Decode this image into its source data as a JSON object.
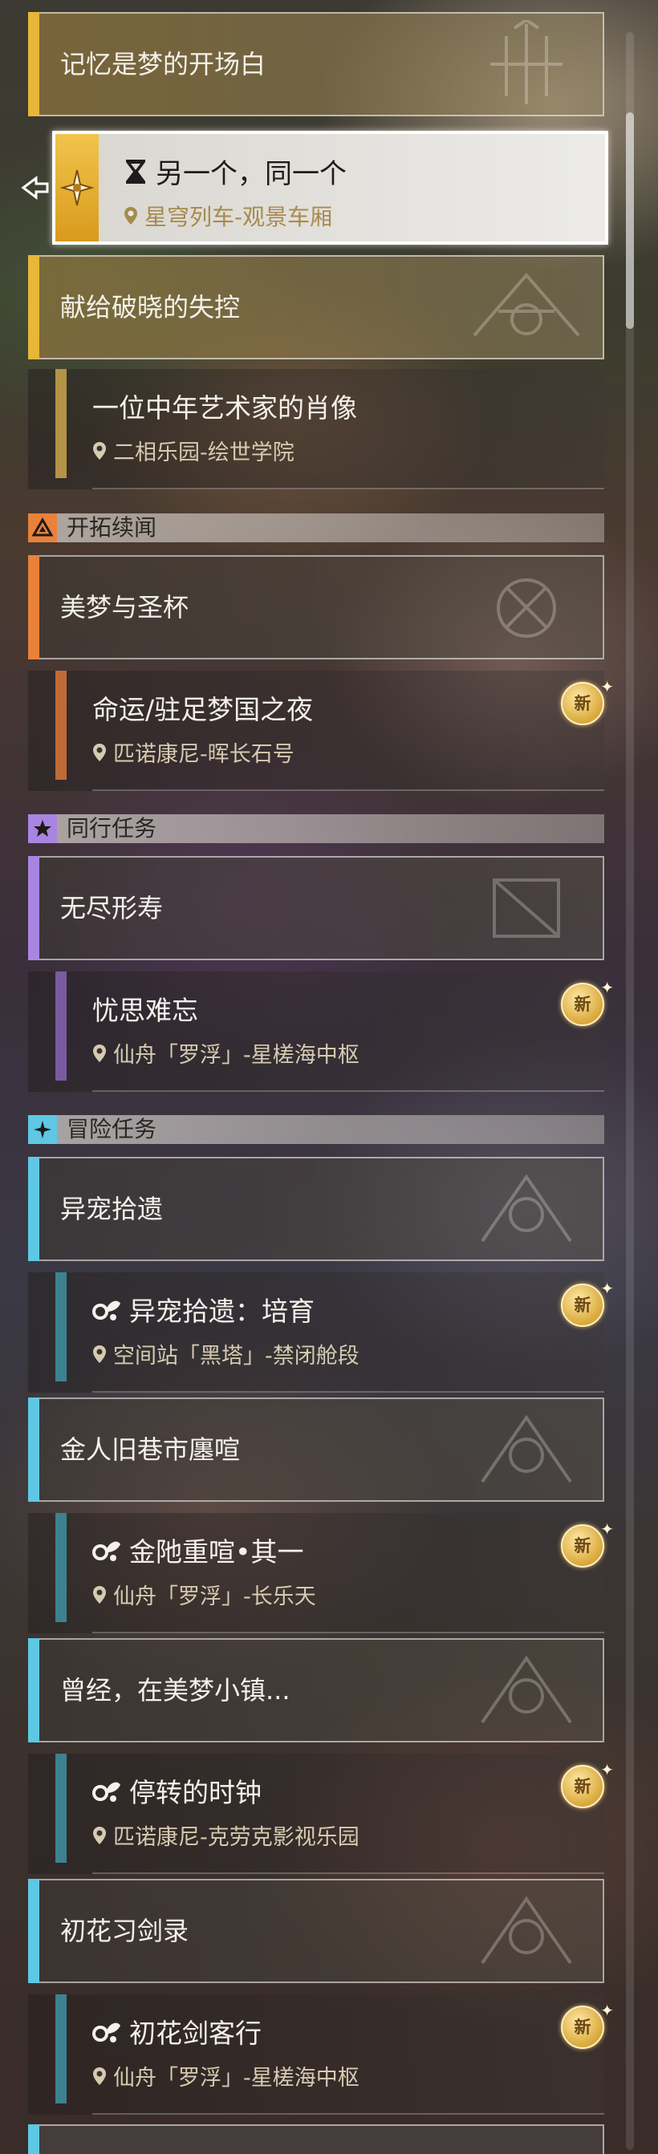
{
  "colors": {
    "gold": "#e8b73a",
    "orange": "#e9813a",
    "purple": "#a985e2",
    "cyan": "#5ec8e4",
    "sub_gold": "#b59447",
    "sub_orange": "#c06a35",
    "sub_purple": "#7b5aa0",
    "sub_teal": "#3c8290"
  },
  "trailblaze": {
    "main1": {
      "title": "记忆是梦的开场白",
      "icon": "trailblaze-emblem"
    },
    "selected": {
      "title": "另一个，同一个",
      "location": "星穹列车-观景车厢",
      "icon": "hourglass-icon"
    },
    "main2": {
      "title": "献给破晓的失控"
    },
    "sub2": {
      "title": "一位中年艺术家的肖像",
      "location": "二相乐园-绘世学院"
    }
  },
  "categories": {
    "continuance": "开拓续闻",
    "companion": "同行任务",
    "adventure": "冒险任务"
  },
  "continuance": {
    "main": {
      "title": "美梦与圣杯"
    },
    "sub": {
      "title": "命运/驻足梦国之夜",
      "location": "匹诺康尼-晖长石号",
      "badge": "新"
    }
  },
  "companion": {
    "main": {
      "title": "无尽形寿"
    },
    "sub": {
      "title": "忧思难忘",
      "location": "仙舟「罗浮」-星槎海中枢",
      "badge": "新"
    }
  },
  "adventure": [
    {
      "main": "异宠拾遗",
      "sub": "异宠拾遗：培育",
      "location": "空间站「黑塔」-禁闭舱段",
      "badge": "新"
    },
    {
      "main": "金人旧巷市廛喧",
      "sub": "金阤重喧•其一",
      "location": "仙舟「罗浮」-长乐天",
      "badge": "新"
    },
    {
      "main": "曾经，在美梦小镇...",
      "sub": "停转的时钟",
      "location": "匹诺康尼-克劳克影视乐园",
      "badge": "新"
    },
    {
      "main": "初花习剑录",
      "sub": "初花剑客行",
      "location": "仙舟「罗浮」-星槎海中枢",
      "badge": "新"
    }
  ]
}
